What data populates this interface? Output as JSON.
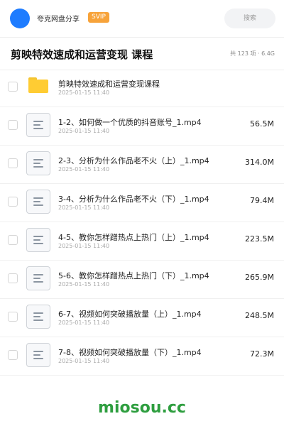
{
  "header": {
    "share_name": "夸克网盘分享",
    "badge": "SVIP",
    "search_placeholder": "搜索"
  },
  "folder": {
    "title": "剪映特效速成和运营变现 课程",
    "summary": "共 123 项 · 6.4G"
  },
  "files": [
    {
      "name": "剪映特效速成和运营变现课程",
      "date": "2025-01-15 11:40",
      "size": "",
      "type": "folder"
    },
    {
      "name": "1-2、如何做一个优质的抖音账号_1.mp4",
      "date": "2025-01-15 11:40",
      "size": "56.5M",
      "type": "doc"
    },
    {
      "name": "2-3、分析为什么作品老不火（上）_1.mp4",
      "date": "2025-01-15 11:40",
      "size": "314.0M",
      "type": "doc"
    },
    {
      "name": "3-4、分析为什么作品老不火（下）_1.mp4",
      "date": "2025-01-15 11:40",
      "size": "79.4M",
      "type": "doc"
    },
    {
      "name": "4-5、教你怎样蹭热点上热门（上）_1.mp4",
      "date": "2025-01-15 11:40",
      "size": "223.5M",
      "type": "doc"
    },
    {
      "name": "5-6、教你怎样蹭热点上热门（下）_1.mp4",
      "date": "2025-01-15 11:40",
      "size": "265.9M",
      "type": "doc"
    },
    {
      "name": "6-7、视频如何突破播放量（上）_1.mp4",
      "date": "2025-01-15 11:40",
      "size": "248.5M",
      "type": "doc"
    },
    {
      "name": "7-8、视频如何突破播放量（下）_1.mp4",
      "date": "2025-01-15 11:40",
      "size": "72.3M",
      "type": "doc"
    }
  ],
  "footer": {
    "brand": "miosou.cc"
  },
  "colors": {
    "avatar": "#1e7cff",
    "svip_badge": "#f7a33a",
    "folder": "#ffcc33",
    "brand": "#2e9e3f"
  }
}
